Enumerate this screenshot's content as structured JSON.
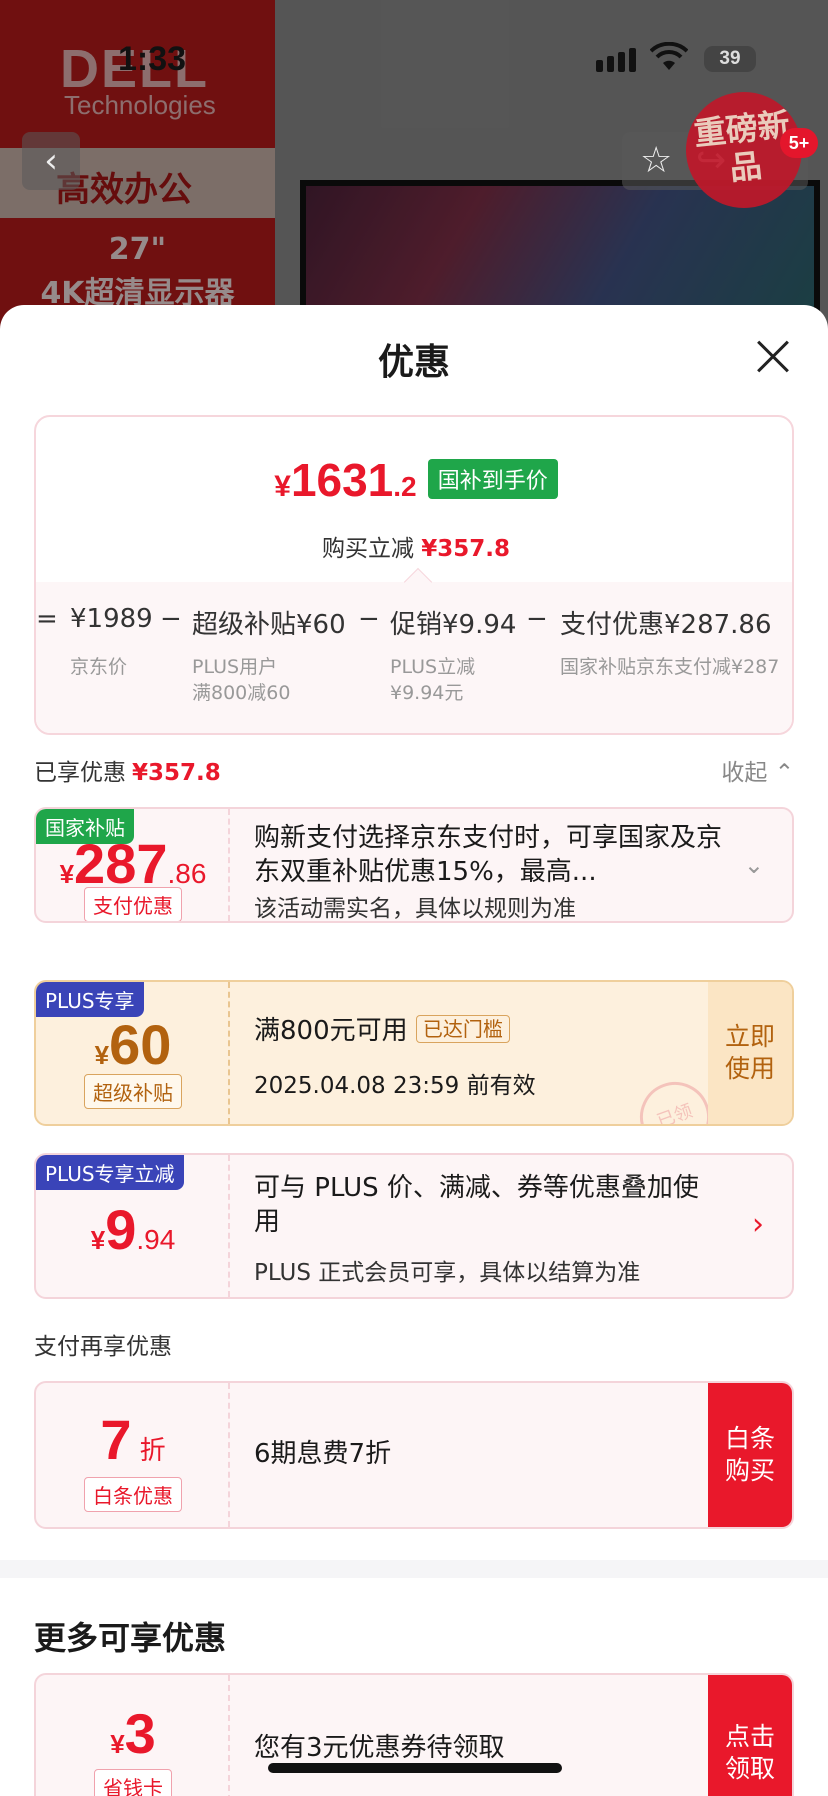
{
  "status_bar": {
    "time": "1:33",
    "battery": "39"
  },
  "background_page": {
    "brand": "DELL",
    "brand_sub": "Technologies",
    "banner_headline": "高效办公",
    "banner_size": "27\"",
    "banner_desc": "4K超清显示器",
    "stamp_text": "重磅新品",
    "badge_count": "5+"
  },
  "sheet": {
    "title": "优惠"
  },
  "price_box": {
    "currency": "¥",
    "final_int": "1631",
    "final_dec": ".2",
    "tag": "国补到手价",
    "reduce_label": "购买立减",
    "reduce_amount": "¥357.8",
    "formula": [
      {
        "op": "=",
        "value": "¥1989",
        "desc1": "京东价",
        "desc2": ""
      },
      {
        "op": "−",
        "value": "超级补贴¥60",
        "desc1": "PLUS用户",
        "desc2": "满800减60"
      },
      {
        "op": "−",
        "value": "促销¥9.94",
        "desc1": "PLUS立减",
        "desc2": "¥9.94元"
      },
      {
        "op": "−",
        "value": "支付优惠¥287.86",
        "desc1": "国家补贴京东支付减¥287",
        "desc2": ""
      }
    ]
  },
  "enjoyed": {
    "label": "已享优惠",
    "amount": "¥357.8",
    "collapse": "收起"
  },
  "offers": [
    {
      "ribbon": "国家补贴",
      "ribbon_color": "#1fa64a",
      "yen": "¥",
      "int": "287",
      "dec": ".86",
      "chip": "支付优惠",
      "text": "购新支付选择京东支付时，可享国家及京东双重补贴优惠15%，最高...",
      "note": "该活动需实名，具体以规则为准"
    },
    {
      "ribbon": "PLUS专享",
      "ribbon_color": "#3a44b8",
      "yen": "¥",
      "int": "60",
      "dec": "",
      "chip": "超级补贴",
      "text": "满800元可用",
      "threshold_tag": "已达门槛",
      "note": "2025.04.08 23:59 前有效",
      "button": "立即使用",
      "claimed_stamp": "已领"
    },
    {
      "ribbon": "PLUS专享立减",
      "ribbon_color": "#3a44b8",
      "yen": "¥",
      "int": "9",
      "dec": ".94",
      "chip": "",
      "text": "可与 PLUS 价、满减、券等优惠叠加使用",
      "note": "PLUS 正式会员可享，具体以结算为准"
    }
  ],
  "pay_section": {
    "label": "支付再享优惠",
    "offer": {
      "int": "7",
      "unit": "折",
      "chip": "白条优惠",
      "text": "6期息费7折",
      "button": "白条购买"
    }
  },
  "more_section": {
    "title": "更多可享优惠",
    "offer": {
      "yen": "¥",
      "int": "3",
      "chip": "省钱卡",
      "text": "您有3元优惠券待领取",
      "button": "点击领取"
    }
  },
  "colors": {
    "accent_red": "#e9182b",
    "green": "#1fa64a",
    "plus_blue": "#3a44b8",
    "gold": "#b2620f"
  }
}
